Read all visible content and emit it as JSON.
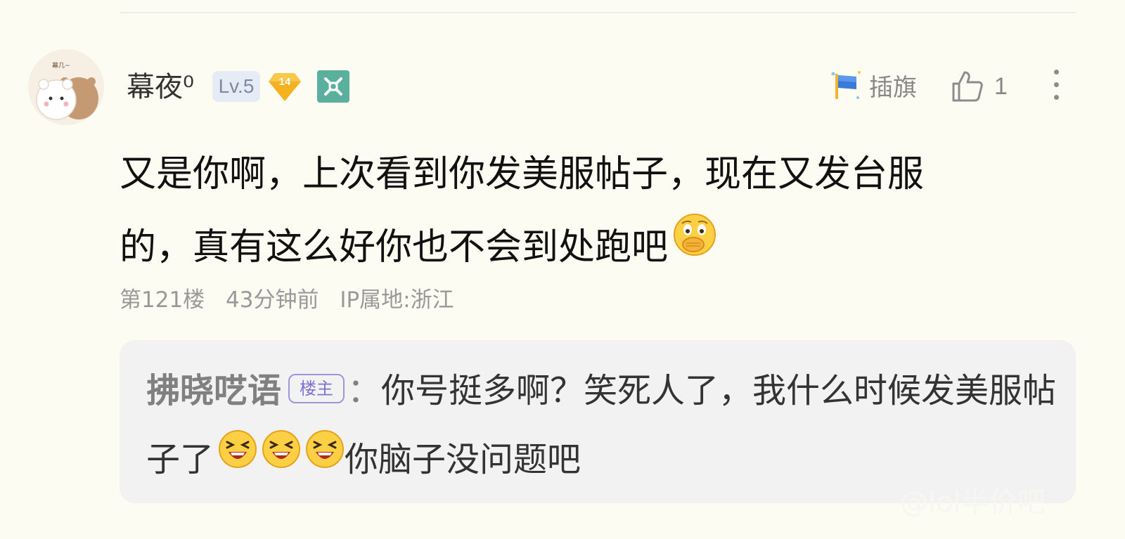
{
  "comment": {
    "username": "幕夜⁰",
    "level": "Lv.5",
    "diamond_badge": "14",
    "avatar_text": "幕几~",
    "body_line1": "又是你啊，上次看到你发美服帖子，现在又发台服",
    "body_line2": "的，真有这么好你也不会到处跑吧",
    "floor": "第121楼",
    "time": "43分钟前",
    "ip_location": "IP属地:浙江"
  },
  "actions": {
    "flag_label": "插旗",
    "like_count": "1"
  },
  "reply": {
    "author": "拂晓呓语",
    "op_badge": "楼主",
    "colon": "：",
    "text_part1": "你号挺多啊？笑死人了，我什么时候发美服帖子了",
    "text_part2": "你脑子没问题吧"
  },
  "watermark": "@lol半价吧",
  "icons": {
    "avatar": "avatar-image",
    "diamond": "diamond-badge-icon",
    "green": "green-badge-icon",
    "flag": "flag-icon",
    "like": "thumbs-up-icon",
    "more": "more-icon",
    "emoji_cover_mouth": "cover-mouth-emoji-icon",
    "emoji_grin": "grin-emoji-icon"
  },
  "colors": {
    "background": "#fdfcf3",
    "reply_background": "#f3f2f2",
    "op_badge": "#7e72cf",
    "green_badge": "#5ab09c",
    "diamond_badge": "#f5b21f"
  }
}
